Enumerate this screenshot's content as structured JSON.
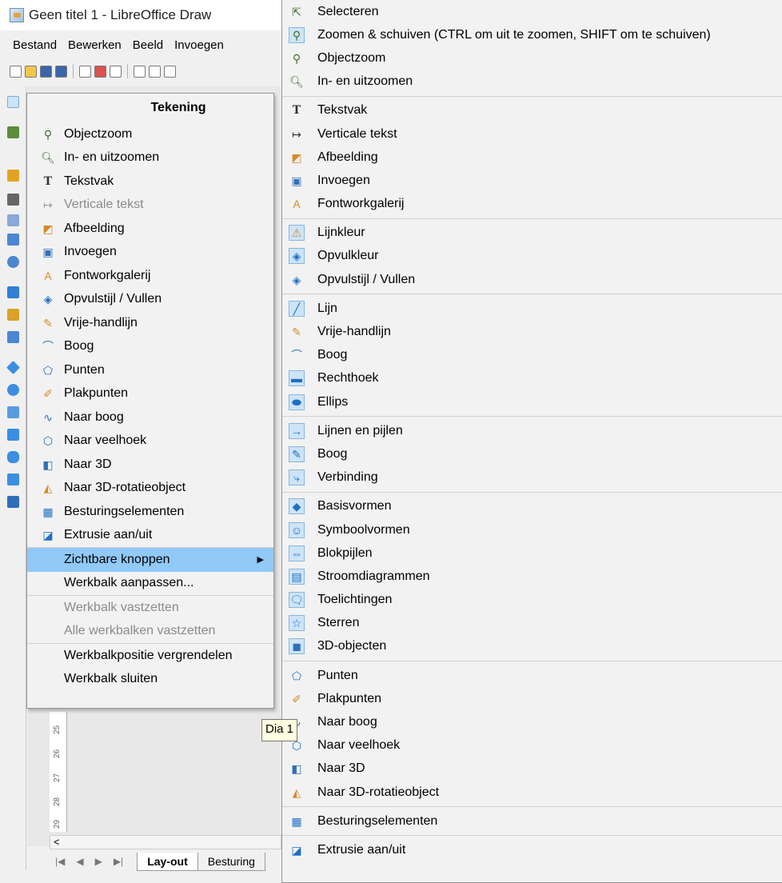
{
  "window": {
    "title": "Geen titel 1 - LibreOffice Draw"
  },
  "menubar": [
    "Bestand",
    "Bewerken",
    "Beeld",
    "Invoegen"
  ],
  "tooltip": "Dia 1",
  "ruler": [
    "25",
    "26",
    "27",
    "28",
    "29"
  ],
  "hscroll": {
    "left_arrow": "<"
  },
  "tabs": {
    "nav": [
      "|◀",
      "◀",
      "▶",
      "▶|"
    ],
    "active": "Lay-out",
    "other": "Besturing"
  },
  "context_menu": {
    "title": "Tekening",
    "items": [
      {
        "label": "Objectzoom",
        "icon": "objectzoom-icon",
        "glyph": "⚲",
        "disabled": false
      },
      {
        "label": "In- en uitzoomen",
        "icon": "zoom-icon",
        "glyph": "🔍︎",
        "disabled": false
      },
      {
        "label": "Tekstvak",
        "icon": "text-box-icon",
        "glyph": "T",
        "disabled": false
      },
      {
        "label": "Verticale tekst",
        "icon": "vertical-text-icon",
        "glyph": "↦",
        "disabled": true
      },
      {
        "label": "Afbeelding",
        "icon": "image-icon",
        "glyph": "◩",
        "disabled": false
      },
      {
        "label": "Invoegen",
        "icon": "insert-icon",
        "glyph": "▣",
        "disabled": false
      },
      {
        "label": "Fontworkgalerij",
        "icon": "fontwork-icon",
        "glyph": "A",
        "disabled": false
      },
      {
        "label": "Opvulstijl / Vullen",
        "icon": "fill-style-icon",
        "glyph": "◈",
        "disabled": false
      },
      {
        "label": "Vrije-handlijn",
        "icon": "freehand-line-icon",
        "glyph": "✎",
        "disabled": false
      },
      {
        "label": "Boog",
        "icon": "curve-icon",
        "glyph": "⌒",
        "disabled": false
      },
      {
        "label": "Punten",
        "icon": "points-icon",
        "glyph": "⬠",
        "disabled": false
      },
      {
        "label": "Plakpunten",
        "icon": "glue-points-icon",
        "glyph": "✐",
        "disabled": false
      },
      {
        "label": "Naar boog",
        "icon": "to-curve-icon",
        "glyph": "∿",
        "disabled": false
      },
      {
        "label": "Naar veelhoek",
        "icon": "to-polygon-icon",
        "glyph": "⬡",
        "disabled": false
      },
      {
        "label": "Naar 3D",
        "icon": "to-3d-icon",
        "glyph": "◧",
        "disabled": false
      },
      {
        "label": "Naar 3D-rotatieobject",
        "icon": "to-3d-rotation-icon",
        "glyph": "◭",
        "disabled": false
      },
      {
        "label": "Besturingselementen",
        "icon": "controls-icon",
        "glyph": "▦",
        "disabled": false
      },
      {
        "label": "Extrusie aan/uit",
        "icon": "extrusion-icon",
        "glyph": "◪",
        "disabled": false
      }
    ],
    "visible_buttons": "Zichtbare knoppen",
    "submenu_arrow": "▶",
    "customize": "Werkbalk aanpassen...",
    "dock": "Werkbalk vastzetten",
    "dock_all": "Alle werkbalken vastzetten",
    "lock": "Werkbalkpositie vergrendelen",
    "close": "Werkbalk sluiten"
  },
  "submenu": {
    "groups": [
      [
        {
          "label": "Selecteren",
          "icon": "select-arrow-icon",
          "glyph": "⇱",
          "checked": false
        },
        {
          "label": "Zoomen & schuiven (CTRL om uit te zoomen, SHIFT om te schuiven)",
          "icon": "zoom-pan-icon",
          "glyph": "⚲",
          "checked": true
        },
        {
          "label": "Objectzoom",
          "icon": "objectzoom-icon",
          "glyph": "⚲",
          "checked": false
        },
        {
          "label": "In- en uitzoomen",
          "icon": "zoom-icon",
          "glyph": "🔍︎",
          "checked": false
        }
      ],
      [
        {
          "label": "Tekstvak",
          "icon": "text-box-icon",
          "glyph": "T",
          "checked": false
        },
        {
          "label": "Verticale tekst",
          "icon": "vertical-text-icon",
          "glyph": "↦",
          "checked": false
        },
        {
          "label": "Afbeelding",
          "icon": "image-icon",
          "glyph": "◩",
          "checked": false
        },
        {
          "label": "Invoegen",
          "icon": "insert-icon",
          "glyph": "▣",
          "checked": false
        },
        {
          "label": "Fontworkgalerij",
          "icon": "fontwork-icon",
          "glyph": "A",
          "checked": false
        }
      ],
      [
        {
          "label": "Lijnkleur",
          "icon": "line-color-icon",
          "glyph": "⚠",
          "checked": true
        },
        {
          "label": "Opvulkleur",
          "icon": "fill-color-icon",
          "glyph": "◈",
          "checked": true
        },
        {
          "label": "Opvulstijl / Vullen",
          "icon": "fill-style-icon",
          "glyph": "◈",
          "checked": false
        }
      ],
      [
        {
          "label": "Lijn",
          "icon": "line-icon",
          "glyph": "╱",
          "checked": true
        },
        {
          "label": "Vrije-handlijn",
          "icon": "freehand-line-icon",
          "glyph": "✎",
          "checked": false
        },
        {
          "label": "Boog",
          "icon": "curve-icon",
          "glyph": "⌒",
          "checked": false
        },
        {
          "label": "Rechthoek",
          "icon": "rectangle-icon",
          "glyph": "▬",
          "checked": true
        },
        {
          "label": "Ellips",
          "icon": "ellipse-icon",
          "glyph": "⬬",
          "checked": true
        }
      ],
      [
        {
          "label": "Lijnen en pijlen",
          "icon": "lines-arrows-icon",
          "glyph": "→",
          "checked": true
        },
        {
          "label": "Boog",
          "icon": "curve-icon",
          "glyph": "✎",
          "checked": true
        },
        {
          "label": "Verbinding",
          "icon": "connector-icon",
          "glyph": "⤷",
          "checked": true
        }
      ],
      [
        {
          "label": "Basisvormen",
          "icon": "basic-shapes-icon",
          "glyph": "◆",
          "checked": true
        },
        {
          "label": "Symboolvormen",
          "icon": "symbol-shapes-icon",
          "glyph": "☺",
          "checked": true
        },
        {
          "label": "Blokpijlen",
          "icon": "block-arrows-icon",
          "glyph": "⇔",
          "checked": true
        },
        {
          "label": "Stroomdiagrammen",
          "icon": "flowchart-icon",
          "glyph": "▤",
          "checked": true
        },
        {
          "label": "Toelichtingen",
          "icon": "callouts-icon",
          "glyph": "🗨︎",
          "checked": true
        },
        {
          "label": "Sterren",
          "icon": "stars-icon",
          "glyph": "☆",
          "checked": true
        },
        {
          "label": "3D-objecten",
          "icon": "3d-objects-icon",
          "glyph": "◼",
          "checked": true
        }
      ],
      [
        {
          "label": "Punten",
          "icon": "points-icon",
          "glyph": "⬠",
          "checked": false
        },
        {
          "label": "Plakpunten",
          "icon": "glue-points-icon",
          "glyph": "✐",
          "checked": false
        },
        {
          "label": "Naar boog",
          "icon": "to-curve-icon",
          "glyph": "∿",
          "checked": false
        },
        {
          "label": "Naar veelhoek",
          "icon": "to-polygon-icon",
          "glyph": "⬡",
          "checked": false
        },
        {
          "label": "Naar 3D",
          "icon": "to-3d-icon",
          "glyph": "◧",
          "checked": false
        },
        {
          "label": "Naar 3D-rotatieobject",
          "icon": "to-3d-rotation-icon",
          "glyph": "◭",
          "checked": false
        }
      ],
      [
        {
          "label": "Besturingselementen",
          "icon": "controls-icon",
          "glyph": "▦",
          "checked": false
        }
      ],
      [
        {
          "label": "Extrusie aan/uit",
          "icon": "extrusion-icon",
          "glyph": "◪",
          "checked": false
        }
      ]
    ]
  },
  "colors": {
    "highlight": "#91c9f7",
    "check_bg": "#cce4f7",
    "menu_bg": "#f2f2f2",
    "tooltip_bg": "#ffffe1"
  }
}
